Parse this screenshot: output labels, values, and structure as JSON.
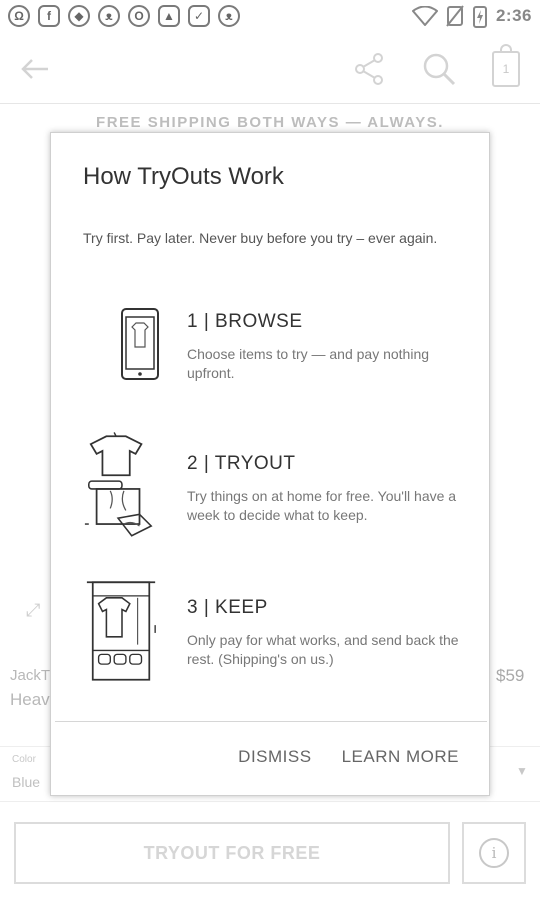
{
  "status_bar": {
    "time": "2:36",
    "notification_icons": [
      "chat-icon",
      "facebook-icon",
      "messenger-icon",
      "cat-icon",
      "opera-icon",
      "lock-icon",
      "image-icon",
      "cat-face-icon"
    ]
  },
  "toolbar": {
    "cart_count": "1"
  },
  "banner": "FREE SHIPPING BOTH WAYS — ALWAYS.",
  "background_product": {
    "brand_fragment": "JackT",
    "name_fragment": "Heav",
    "price_fragment": "$59",
    "color_label": "Color",
    "color_value": "Blue"
  },
  "cta": {
    "primary_label": "TRYOUT FOR FREE",
    "info_glyph": "i"
  },
  "dialog": {
    "title": "How TryOuts Work",
    "intro": "Try first. Pay later. Never buy before you try – ever again.",
    "steps": [
      {
        "heading": "1 |  BROWSE",
        "description": "Choose items to try — and pay nothing upfront."
      },
      {
        "heading": "2 |  TRYOUT",
        "description": "Try things on at home for free. You'll have a week to decide what to keep."
      },
      {
        "heading": "3 |  KEEP",
        "description": "Only pay for what works, and send back the rest. (Shipping's on us.)"
      }
    ],
    "dismiss_label": "DISMISS",
    "learn_more_label": "LEARN MORE"
  },
  "colors": {
    "text_primary": "#333333",
    "text_secondary": "#777777",
    "dim_background": "#cfcfcf"
  }
}
